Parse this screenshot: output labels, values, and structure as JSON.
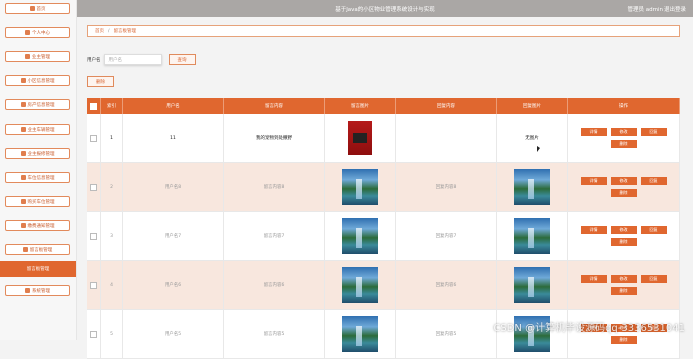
{
  "header": {
    "title": "基于Java的小区物业管理系统设计与实现",
    "user": "管理员 admin",
    "logout": "退出登录"
  },
  "sidebar": {
    "items": [
      {
        "label": "首页",
        "icon": "home-icon"
      },
      {
        "label": "个人中心",
        "icon": "user-icon"
      },
      {
        "label": "业主管理",
        "icon": "grid-icon"
      },
      {
        "label": "小区信息管理",
        "icon": "building-icon"
      },
      {
        "label": "房产信息管理",
        "icon": "grid-icon"
      },
      {
        "label": "业主车辆管理",
        "icon": "grid-icon"
      },
      {
        "label": "业主报修管理",
        "icon": "trophy-icon"
      },
      {
        "label": "车位信息管理",
        "icon": "grid-icon"
      },
      {
        "label": "购买车位管理",
        "icon": "grid-icon"
      },
      {
        "label": "缴费通知管理",
        "icon": "grid-icon"
      },
      {
        "label": "留言板管理",
        "icon": "user-icon"
      },
      {
        "label": "留言板管理",
        "icon": "none"
      },
      {
        "label": "系统管理",
        "icon": "user-icon"
      }
    ]
  },
  "breadcrumb": {
    "home": "首页",
    "sep": "/",
    "current": "留言板管理"
  },
  "search": {
    "label": "用户名",
    "placeholder": "用户名",
    "button": "查询"
  },
  "delete_button": "删除",
  "table": {
    "headers": [
      "索引",
      "用户名",
      "留言内容",
      "留言图片",
      "回复内容",
      "回复图片",
      "操作"
    ],
    "rows": [
      {
        "no": "1",
        "user": "11",
        "msg": "我的宠物到处撒野",
        "reply": "",
        "reply_img_text": "无图片",
        "img": "book"
      },
      {
        "no": "2",
        "user": "用户名8",
        "msg": "留言内容8",
        "reply": "回复内容8",
        "reply_img_text": "",
        "img": "landscape"
      },
      {
        "no": "3",
        "user": "用户名7",
        "msg": "留言内容7",
        "reply": "回复内容7",
        "reply_img_text": "",
        "img": "landscape"
      },
      {
        "no": "4",
        "user": "用户名6",
        "msg": "留言内容6",
        "reply": "回复内容6",
        "reply_img_text": "",
        "img": "landscape"
      },
      {
        "no": "5",
        "user": "用户名5",
        "msg": "留言内容5",
        "reply": "回复内容5",
        "reply_img_text": "",
        "img": "landscape"
      }
    ],
    "ops": [
      "详情",
      "修改",
      "回复",
      "删除"
    ]
  },
  "watermark": "CSDN @计算机毕设源码qq-3336531041"
}
